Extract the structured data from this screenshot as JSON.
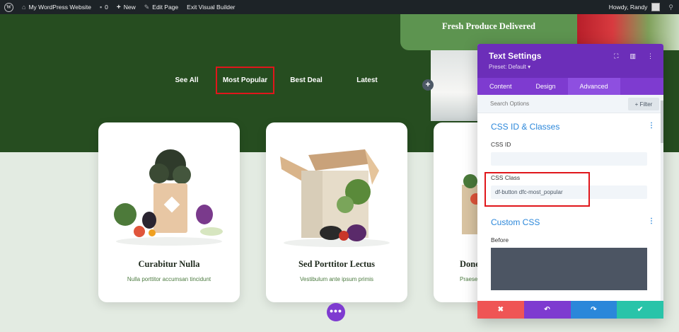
{
  "adminbar": {
    "site_name": "My WordPress Website",
    "comments_count": "0",
    "new_label": "New",
    "edit_page_label": "Edit Page",
    "exit_builder_label": "Exit Visual Builder",
    "howdy": "Howdy, Randy"
  },
  "hero": {
    "banner_title": "Fresh Produce Delivered",
    "filters": [
      "See All",
      "Most Popular",
      "Best Deal",
      "Latest"
    ],
    "active_filter": "Most Popular"
  },
  "cards": [
    {
      "title": "Curabitur Nulla",
      "subtitle": "Nulla porttitor accumsan tincidunt"
    },
    {
      "title": "Sed Porttitor Lectus",
      "subtitle": "Vestibulum ante ipsum primis"
    },
    {
      "title": "Done",
      "subtitle": "Praese"
    }
  ],
  "panel": {
    "title": "Text Settings",
    "preset": "Preset: Default ▾",
    "tabs": [
      "Content",
      "Design",
      "Advanced"
    ],
    "active_tab": "Advanced",
    "search_placeholder": "Search Options",
    "filter_label": "+ Filter",
    "section_css_id_classes": "CSS ID & Classes",
    "css_id_label": "CSS ID",
    "css_id_value": "",
    "css_class_label": "CSS Class",
    "css_class_value": "df-button dfc-most_popular",
    "section_custom_css": "Custom CSS",
    "before_label": "Before"
  },
  "colors": {
    "hero_green": "#264d20",
    "accent_purple": "#7e3bd0",
    "highlight_red": "#e0161b",
    "cancel": "#ef5555",
    "undo": "#7e3bd0",
    "redo": "#2b87da",
    "save": "#29c4a9"
  },
  "icons": {
    "cancel": "✖",
    "undo": "↶",
    "redo": "↷",
    "save": "✔"
  }
}
